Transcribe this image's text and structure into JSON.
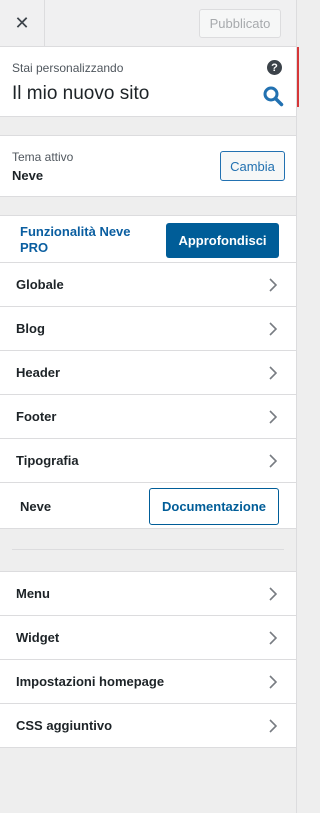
{
  "topbar": {
    "close_icon": "close-icon",
    "publish_label": "Pubblicato"
  },
  "info": {
    "subtitle": "Stai personalizzando",
    "site_title": "Il mio nuovo sito",
    "help_glyph": "?",
    "help_icon": "help-icon",
    "search_icon": "search-icon"
  },
  "theme": {
    "label": "Tema attivo",
    "name": "Neve",
    "change_label": "Cambia"
  },
  "pro": {
    "text": "Funzionalità Neve PRO",
    "button_label": "Approfondisci"
  },
  "sections": [
    {
      "label": "Globale"
    },
    {
      "label": "Blog"
    },
    {
      "label": "Header"
    },
    {
      "label": "Footer"
    },
    {
      "label": "Tipografia"
    }
  ],
  "docs": {
    "label": "Neve",
    "button_label": "Documentazione"
  },
  "menu_sections": [
    {
      "label": "Menu"
    },
    {
      "label": "Widget"
    },
    {
      "label": "Impostazioni homepage"
    },
    {
      "label": "CSS aggiuntivo"
    }
  ],
  "colors": {
    "accent": "#2271b1",
    "brand": "#005d98",
    "active_indicator": "#d63638"
  }
}
